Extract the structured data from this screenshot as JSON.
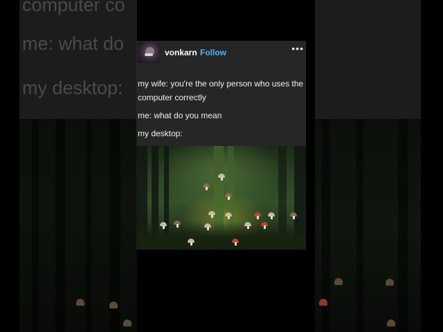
{
  "post": {
    "username": "vonkarn",
    "follow_label": "Follow",
    "more_label": "•••",
    "lines": [
      "my wife: you're the only person who uses the computer correctly",
      "me: what do you mean",
      "my desktop:"
    ]
  },
  "background_text": {
    "line1": "computer co",
    "line2": "me: what do",
    "line3": "my desktop:"
  },
  "desktop_icons": [
    "mushroom-icon",
    "mushroom-icon",
    "mushroom-icon",
    "mushroom-icon",
    "mushroom-icon",
    "mushroom-icon",
    "mushroom-icon",
    "mushroom-icon",
    "mushroom-icon",
    "mushroom-icon",
    "mushroom-icon",
    "mushroom-icon",
    "mushroom-icon",
    "mushroom-icon",
    "mushroom-icon"
  ],
  "colors": {
    "follow": "#4fb6ff",
    "card_bg": "#262626",
    "page_bg": "#000000"
  }
}
